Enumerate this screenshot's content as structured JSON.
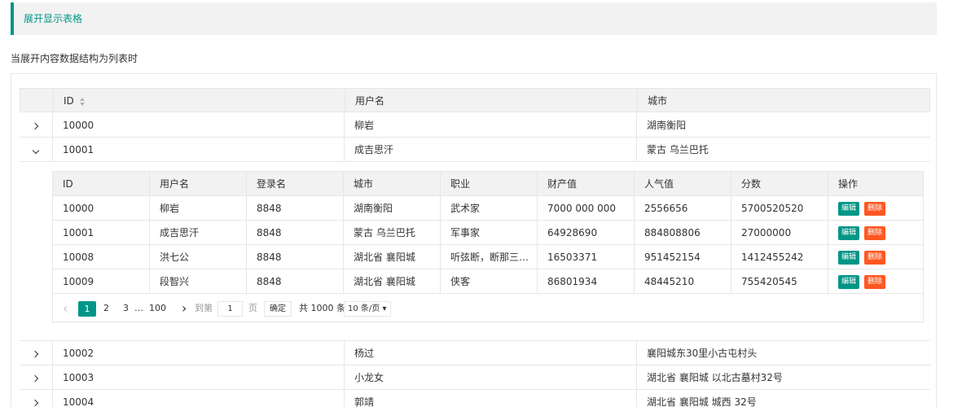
{
  "header": {
    "title": "展开显示表格"
  },
  "subtitle": "当展开内容数据结构为列表时",
  "main_table": {
    "columns": [
      "ID",
      "用户名",
      "城市"
    ],
    "rows": [
      {
        "id": "10000",
        "user": "柳岩",
        "city": "湖南衡阳"
      },
      {
        "id": "10001",
        "user": "成吉思汗",
        "city": "蒙古 乌兰巴托"
      },
      {
        "id": "10002",
        "user": "杨过",
        "city": "襄阳城东30里小古屯村头"
      },
      {
        "id": "10003",
        "user": "小龙女",
        "city": "湖北省 襄阳城 以北古墓村32号"
      },
      {
        "id": "10004",
        "user": "郭靖",
        "city": "湖北省 襄阳城 城西 32号"
      }
    ]
  },
  "inner_table": {
    "columns": [
      "ID",
      "用户名",
      "登录名",
      "城市",
      "职业",
      "财产值",
      "人气值",
      "分数",
      "操作"
    ],
    "rows": [
      [
        "10000",
        "柳岩",
        "8848",
        "湖南衡阳",
        "武术家",
        "7000 000 000",
        "2556656",
        "5700520520"
      ],
      [
        "10001",
        "成吉思汗",
        "8848",
        "蒙古 乌兰巴托",
        "军事家",
        "64928690",
        "884808806",
        "27000000"
      ],
      [
        "10008",
        "洪七公",
        "8848",
        "湖北省 襄阳城",
        "听弦断，断那三千痴缠",
        "16503371",
        "951452154",
        "1412455242"
      ],
      [
        "10009",
        "段智兴",
        "8848",
        "湖北省 襄阳城",
        "侠客",
        "86801934",
        "48445210",
        "755420545"
      ]
    ],
    "edit_label": "编辑",
    "delete_label": "删除"
  },
  "pager": {
    "prev": "‹",
    "current": "1",
    "page2": "2",
    "page3": "3",
    "ellipsis": "…",
    "last": "100",
    "next": "›",
    "goto_label": "到第",
    "goto_value": "1",
    "page_unit": "页",
    "confirm": "确定",
    "total": "共 1000 条",
    "per_page": "10 条/页"
  }
}
